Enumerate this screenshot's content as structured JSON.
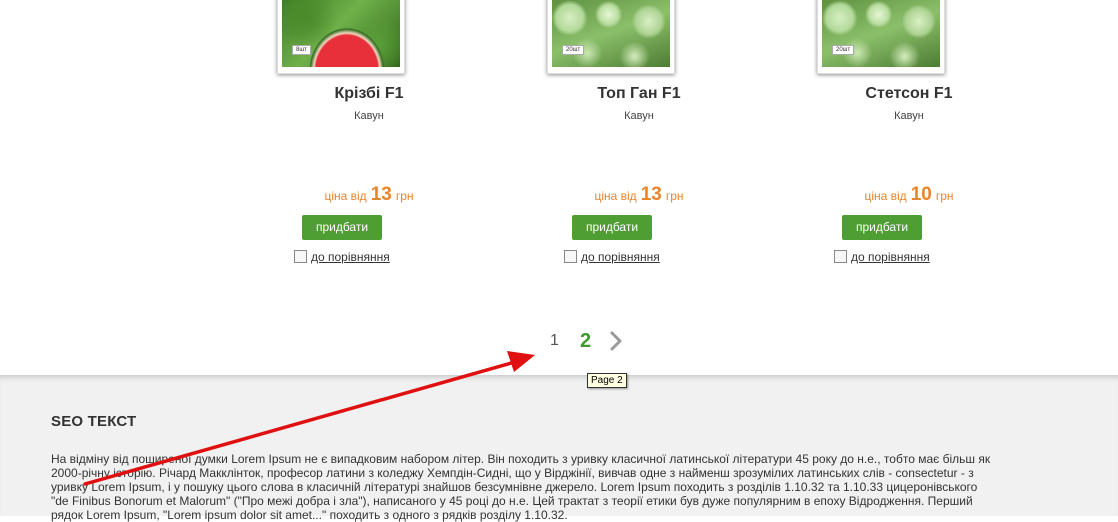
{
  "products": [
    {
      "name": "Крізбі F1",
      "category": "Кавун",
      "price_prefix": "ціна від",
      "price": "13",
      "currency": "грн",
      "buy_label": "придбати",
      "compare_label": "до порівняння",
      "pack": "8шт",
      "image": "watermelon"
    },
    {
      "name": "Топ Ган F1",
      "category": "Кавун",
      "price_prefix": "ціна від",
      "price": "13",
      "currency": "грн",
      "buy_label": "придбати",
      "compare_label": "до порівняння",
      "pack": "20шт",
      "image": "cabbage"
    },
    {
      "name": "Стетсон F1",
      "category": "Кавун",
      "price_prefix": "ціна від",
      "price": "10",
      "currency": "грн",
      "buy_label": "придбати",
      "compare_label": "до порівняння",
      "pack": "20шт",
      "image": "cabbage"
    }
  ],
  "pagination": {
    "pages": [
      "1",
      "2"
    ],
    "current": "2",
    "next_icon": "chevron-right-icon",
    "tooltip": "Page 2"
  },
  "seo": {
    "title": "SEO ТЕКСТ",
    "text": "На відміну від поширеної думки Lorem Ipsum не є випадковим набором літер. Він походить з уривку класичної латинської літератури 45 року до н.е., тобто має більш як 2000-річну історію. Річард Макклінток, професор латини з коледжу Хемпдін-Сидні, що у Вірджінії, вивчав одне з найменш зрозумілих латинських слів - consectetur - з уривку Lorem Ipsum, і у пошуку цього слова в класичній літературі знайшов безсумнівне джерело. Lorem Ipsum походить з розділів 1.10.32 та 1.10.33 цицеронівського \"de Finibus Bonorum et Malorum\" (\"Про межі добра і зла\"), написаного у 45 році до н.е. Цей трактат з теорії етики був дуже популярним в епоху Відродження. Перший рядок Lorem Ipsum, \"Lorem ipsum dolor sit amet...\" походить з одного з рядків розділу 1.10.32."
  },
  "colors": {
    "accent_green": "#4f9e34",
    "price_orange": "#e8842a",
    "annotation_red": "#e01010"
  }
}
